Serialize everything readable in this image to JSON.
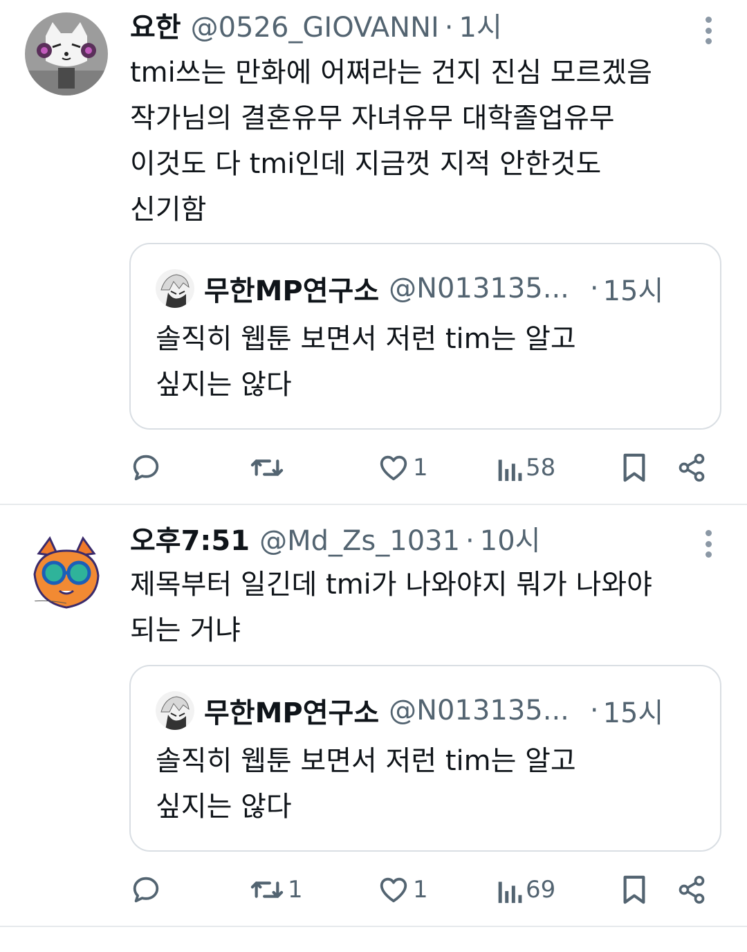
{
  "tweets": [
    {
      "author": {
        "name": "요한",
        "handle": "@0526_GIOVANNI",
        "time": "1시",
        "avatar_icon": "avatar-cat-headphones"
      },
      "text_lines": [
        "tmi쓰는 만화에 어쩌라는 건지 진심 모르겠음",
        "작가님의 결혼유무 자녀유무 대학졸업유무",
        "이것도 다 tmi인데 지금껏 지적 안한것도",
        "신기함"
      ],
      "quote": {
        "name": "무한MP연구소",
        "handle": "@N013135...",
        "time": "15시",
        "text_lines": [
          "솔직히 웹툰 보면서 저런 tim는 알고",
          "싶지는 않다"
        ]
      },
      "actions": {
        "replies": "",
        "retweets": "",
        "likes": "1",
        "views": "58"
      }
    },
    {
      "author": {
        "name": "오후7:51",
        "handle": "@Md_Zs_1031",
        "time": "10시",
        "avatar_icon": "avatar-orange-fox-goggles"
      },
      "text_lines": [
        "제목부터 일긴데 tmi가 나와야지 뭐가 나와야",
        "되는 거냐"
      ],
      "quote": {
        "name": "무한MP연구소",
        "handle": "@N013135...",
        "time": "15시",
        "text_lines": [
          "솔직히 웹툰 보면서 저런 tim는 알고",
          "싶지는 않다"
        ]
      },
      "actions": {
        "replies": "",
        "retweets": "1",
        "likes": "1",
        "views": "69"
      }
    }
  ],
  "separator": "·",
  "colors": {
    "text": "#0f1419",
    "secondary": "#536471",
    "border": "#d9dee3",
    "divider": "#e6e9ec"
  }
}
